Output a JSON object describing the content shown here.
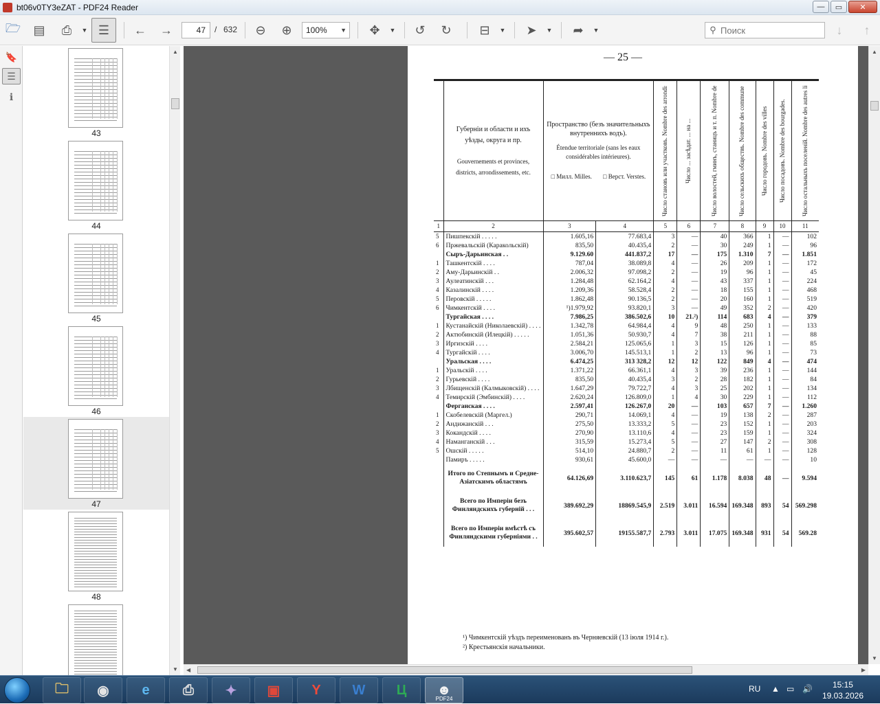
{
  "window": {
    "title": "bt06v0TY3eZAT - PDF24 Reader",
    "minimize": "—",
    "maximize": "▭",
    "close": "✕"
  },
  "toolbar": {
    "page_current": "47",
    "page_sep": "/",
    "page_total": "632",
    "zoom": "100%",
    "search_placeholder": "Поиск"
  },
  "thumbnails": [
    {
      "label": "43"
    },
    {
      "label": "44"
    },
    {
      "label": "45"
    },
    {
      "label": "46"
    },
    {
      "label": "47",
      "active": true
    },
    {
      "label": "48"
    }
  ],
  "document": {
    "page_number": "— 25 —",
    "header": {
      "col2_ru": "Губернiи и области и ихъ уѣзды, округа и пр.",
      "col2_fr": "Gouvernements et provinces, districts, arrondissements, etc.",
      "col3_ru": "Пространство (безъ значительныхъ внутреннихъ водъ).",
      "col3_fr": "Étendue territoriale (sans les eaux considérables intérieures).",
      "col3a": "□ Милл. Milles.",
      "col3b": "□ Верст. Verstes.",
      "v5": "Число становъ или участковъ. Nombre des arrondissements de p lice dans les districts.",
      "v6": "Число ... засѣдат. ... на ... ",
      "v7": "Число волостей, гминъ, станицъ и т. п. Nombre des volosts, des gmines et autres divisions.",
      "v8": "Число сельскихъ обществъ. Nombre des communes rurales.",
      "v9": "Число городовъ. Nombre des villes",
      "v10": "Число посадовъ. Nombre des bourgades.",
      "v11": "Число остальныхъ поселеній. Nombre des autres lieux habités"
    },
    "col_numbers": [
      "1",
      "2",
      "3",
      "4",
      "5",
      "6",
      "7",
      "8",
      "9",
      "10",
      "11"
    ],
    "rows": [
      {
        "idx": "5",
        "name": "Пишпекскій . . . . .",
        "c3": "1.605,16",
        "c4": "77.683,4",
        "c5": "3",
        "c6": "—",
        "c7": "40",
        "c8": "366",
        "c9": "1",
        "c10": "—",
        "c11": "102"
      },
      {
        "idx": "6",
        "name": "Пржевальскій (Каракольскій)",
        "c3": "835,50",
        "c4": "40.435,4",
        "c5": "2",
        "c6": "—",
        "c7": "30",
        "c8": "249",
        "c9": "1",
        "c10": "—",
        "c11": "96"
      },
      {
        "idx": "",
        "name": "Сыръ-Дарьинская . .",
        "c3": "9.129.60",
        "c4": "441.837,2",
        "c5": "17",
        "c6": "—",
        "c7": "175",
        "c8": "1.310",
        "c9": "7",
        "c10": "—",
        "c11": "1.851",
        "bold": true
      },
      {
        "idx": "1",
        "name": "Ташкентскій . . . .",
        "c3": "787,04",
        "c4": "38.089,8",
        "c5": "4",
        "c6": "—",
        "c7": "26",
        "c8": "209",
        "c9": "1",
        "c10": "—",
        "c11": "172"
      },
      {
        "idx": "2",
        "name": "Аму-Дарьинскій . .",
        "c3": "2.006,32",
        "c4": "97.098,2",
        "c5": "2",
        "c6": "—",
        "c7": "19",
        "c8": "96",
        "c9": "1",
        "c10": "—",
        "c11": "45"
      },
      {
        "idx": "3",
        "name": "Аулеатинскій . . .",
        "c3": "1.284,48",
        "c4": "62.164,2",
        "c5": "4",
        "c6": "—",
        "c7": "43",
        "c8": "337",
        "c9": "1",
        "c10": "—",
        "c11": "224"
      },
      {
        "idx": "4",
        "name": "Казалинскій . . . .",
        "c3": "1.209,36",
        "c4": "58.528,4",
        "c5": "2",
        "c6": "—",
        "c7": "18",
        "c8": "155",
        "c9": "1",
        "c10": "—",
        "c11": "468"
      },
      {
        "idx": "5",
        "name": "Перовскій . . . . .",
        "c3": "1.862,48",
        "c4": "90.136,5",
        "c5": "2",
        "c6": "—",
        "c7": "20",
        "c8": "160",
        "c9": "1",
        "c10": "—",
        "c11": "519"
      },
      {
        "idx": "6",
        "name": "Чимкентскій . . . .",
        "c3": "¹)1.979,92",
        "c4": "93.820,1",
        "c5": "3",
        "c6": "—",
        "c7": "49",
        "c8": "352",
        "c9": "2",
        "c10": "—",
        "c11": "420"
      },
      {
        "idx": "",
        "name": "Тургайская . . . .",
        "c3": "7.986,25",
        "c4": "386.502,6",
        "c5": "10",
        "c6": "21.²)",
        "c7": "114",
        "c8": "683",
        "c9": "4",
        "c10": "—",
        "c11": "379",
        "bold": true
      },
      {
        "idx": "1",
        "name": "Кустанайскій (Николаевскій) . . . .",
        "c3": "1.342,78",
        "c4": "64.984,4",
        "c5": "4",
        "c6": "9",
        "c7": "48",
        "c8": "250",
        "c9": "1",
        "c10": "—",
        "c11": "133"
      },
      {
        "idx": "2",
        "name": "Актюбинскій (Илецкій) . . . . .",
        "c3": "1.051,36",
        "c4": "50.930,7",
        "c5": "4",
        "c6": "7",
        "c7": "38",
        "c8": "211",
        "c9": "1",
        "c10": "—",
        "c11": "88"
      },
      {
        "idx": "3",
        "name": "Иргизскій . . . .",
        "c3": "2.584,21",
        "c4": "125.065,6",
        "c5": "1",
        "c6": "3",
        "c7": "15",
        "c8": "126",
        "c9": "1",
        "c10": "—",
        "c11": "85"
      },
      {
        "idx": "4",
        "name": "Тургайскій . . . .",
        "c3": "3.006,70",
        "c4": "145.513,1",
        "c5": "1",
        "c6": "2",
        "c7": "13",
        "c8": "96",
        "c9": "1",
        "c10": "—",
        "c11": "73"
      },
      {
        "idx": "",
        "name": "Уральская . . . .",
        "c3": "6.474,25",
        "c4": "313 328,2",
        "c5": "12",
        "c6": "12",
        "c7": "122",
        "c8": "849",
        "c9": "4",
        "c10": "—",
        "c11": "474",
        "bold": true
      },
      {
        "idx": "1",
        "name": "Уральскій . . . .",
        "c3": "1.371,22",
        "c4": "66.361,1",
        "c5": "4",
        "c6": "3",
        "c7": "39",
        "c8": "236",
        "c9": "1",
        "c10": "—",
        "c11": "144"
      },
      {
        "idx": "2",
        "name": "Гурьевскій . . . .",
        "c3": "835,50",
        "c4": "40.435,4",
        "c5": "3",
        "c6": "2",
        "c7": "28",
        "c8": "182",
        "c9": "1",
        "c10": "—",
        "c11": "84"
      },
      {
        "idx": "3",
        "name": "Лбищенскій (Калмыковскій) . . . .",
        "c3": "1.647,29",
        "c4": "79.722,7",
        "c5": "4",
        "c6": "3",
        "c7": "25",
        "c8": "202",
        "c9": "1",
        "c10": "—",
        "c11": "134"
      },
      {
        "idx": "4",
        "name": "Темирскій (Эмбинскій) . . . .",
        "c3": "2.620,24",
        "c4": "126.809,0",
        "c5": "1",
        "c6": "4",
        "c7": "30",
        "c8": "229",
        "c9": "1",
        "c10": "—",
        "c11": "112"
      },
      {
        "idx": "",
        "name": "Ферганская . . . .",
        "c3": "2.597,41",
        "c4": "126.267,0",
        "c5": "20",
        "c6": "—",
        "c7": "103",
        "c8": "657",
        "c9": "7",
        "c10": "—",
        "c11": "1.260",
        "bold": true
      },
      {
        "idx": "1",
        "name": "Скобелевскій (Маргел.)",
        "c3": "290,71",
        "c4": "14.069,1",
        "c5": "4",
        "c6": "—",
        "c7": "19",
        "c8": "138",
        "c9": "2",
        "c10": "—",
        "c11": "287"
      },
      {
        "idx": "2",
        "name": "Андижанскій . . .",
        "c3": "275,50",
        "c4": "13.333,2",
        "c5": "5",
        "c6": "—",
        "c7": "23",
        "c8": "152",
        "c9": "1",
        "c10": "—",
        "c11": "203"
      },
      {
        "idx": "3",
        "name": "Кокандскій . . . .",
        "c3": "270,90",
        "c4": "13.110,6",
        "c5": "4",
        "c6": "—",
        "c7": "23",
        "c8": "159",
        "c9": "1",
        "c10": "—",
        "c11": "324"
      },
      {
        "idx": "4",
        "name": "Наманганскій . . .",
        "c3": "315,59",
        "c4": "15.273,4",
        "c5": "5",
        "c6": "—",
        "c7": "27",
        "c8": "147",
        "c9": "2",
        "c10": "—",
        "c11": "308"
      },
      {
        "idx": "5",
        "name": "Ошскій . . . . .",
        "c3": "514,10",
        "c4": "24.880,7",
        "c5": "2",
        "c6": "—",
        "c7": "11",
        "c8": "61",
        "c9": "1",
        "c10": "—",
        "c11": "128"
      },
      {
        "idx": "",
        "name": "Памиръ . . . . .",
        "c3": "930,61",
        "c4": "45.600,0",
        "c5": "—",
        "c6": "—",
        "c7": "—",
        "c8": "—",
        "c9": "—",
        "c10": "—",
        "c11": "10"
      }
    ],
    "totals": [
      {
        "name": "Итого по Степнымъ и Средне-Азіатскимъ областямъ",
        "c3": "64.126,69",
        "c4": "3.110.623,7",
        "c5": "145",
        "c6": "61",
        "c7": "1.178",
        "c8": "8.038",
        "c9": "48",
        "c10": "—",
        "c11": "9.594"
      },
      {
        "name": "Всего по Имперіи безъ Финляндскихъ губерній . . .",
        "c3": "389.692,29",
        "c4": "18869.545,9",
        "c5": "2.519",
        "c6": "3.011",
        "c7": "16.594",
        "c8": "169.348",
        "c9": "893",
        "c10": "54",
        "c11": "569.298"
      },
      {
        "name": "Всего по Имперіи вмѣстѣ съ Финляндскими губерніями . .",
        "c3": "395.602,57",
        "c4": "19155.587,7",
        "c5": "2.793",
        "c6": "3.011",
        "c7": "17.075",
        "c8": "169.348",
        "c9": "931",
        "c10": "54",
        "c11": "569.28"
      }
    ],
    "footnotes": [
      "¹) Чимкентскій уѣздъ переименованъ въ Черняевскій (13 іюля 1914 г.).",
      "²) Крестьянскія начальники."
    ]
  },
  "taskbar": {
    "items": [
      {
        "name": "explorer",
        "glyph": "🗀"
      },
      {
        "name": "chrome",
        "glyph": "◉"
      },
      {
        "name": "ie",
        "glyph": "e"
      },
      {
        "name": "printer",
        "glyph": "⎙"
      },
      {
        "name": "app-tool",
        "glyph": "✦"
      },
      {
        "name": "floppy",
        "glyph": "▣"
      },
      {
        "name": "yandex",
        "glyph": "Y"
      },
      {
        "name": "word",
        "glyph": "W"
      },
      {
        "name": "app-c",
        "glyph": "Ц"
      },
      {
        "name": "pdf24",
        "glyph": "☻",
        "label": "PDF24",
        "active": true
      }
    ],
    "lang": "RU",
    "time": "15:15",
    "date": "19.03.2026"
  }
}
